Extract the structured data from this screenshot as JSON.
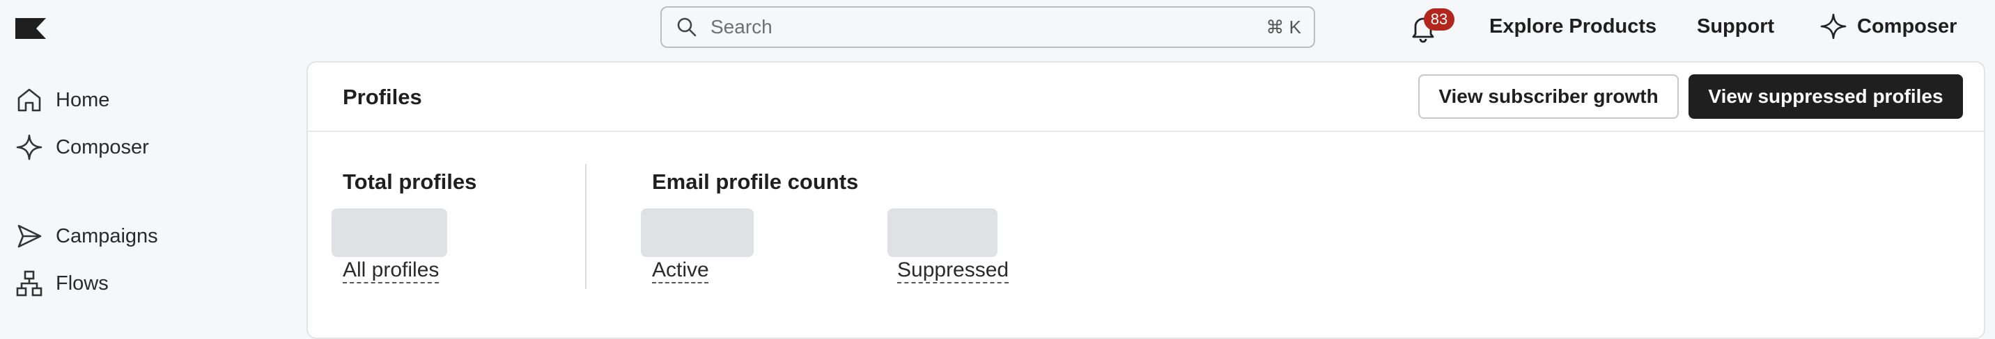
{
  "header": {
    "search": {
      "placeholder": "Search",
      "shortcut": "⌘ K"
    },
    "notifications_count": "83",
    "nav": {
      "explore": "Explore Products",
      "support": "Support",
      "composer": "Composer"
    }
  },
  "sidebar": {
    "items": [
      {
        "label": "Home",
        "icon": "home-icon"
      },
      {
        "label": "Composer",
        "icon": "sparkle-icon"
      },
      {
        "label": "Campaigns",
        "icon": "send-icon"
      },
      {
        "label": "Flows",
        "icon": "flow-icon"
      }
    ]
  },
  "main": {
    "title": "Profiles",
    "buttons": {
      "subscriber_growth": "View subscriber growth",
      "suppressed": "View suppressed profiles"
    },
    "total": {
      "title": "Total profiles",
      "link": "All profiles"
    },
    "email": {
      "title": "Email profile counts",
      "active": "Active",
      "suppressed": "Suppressed"
    }
  }
}
